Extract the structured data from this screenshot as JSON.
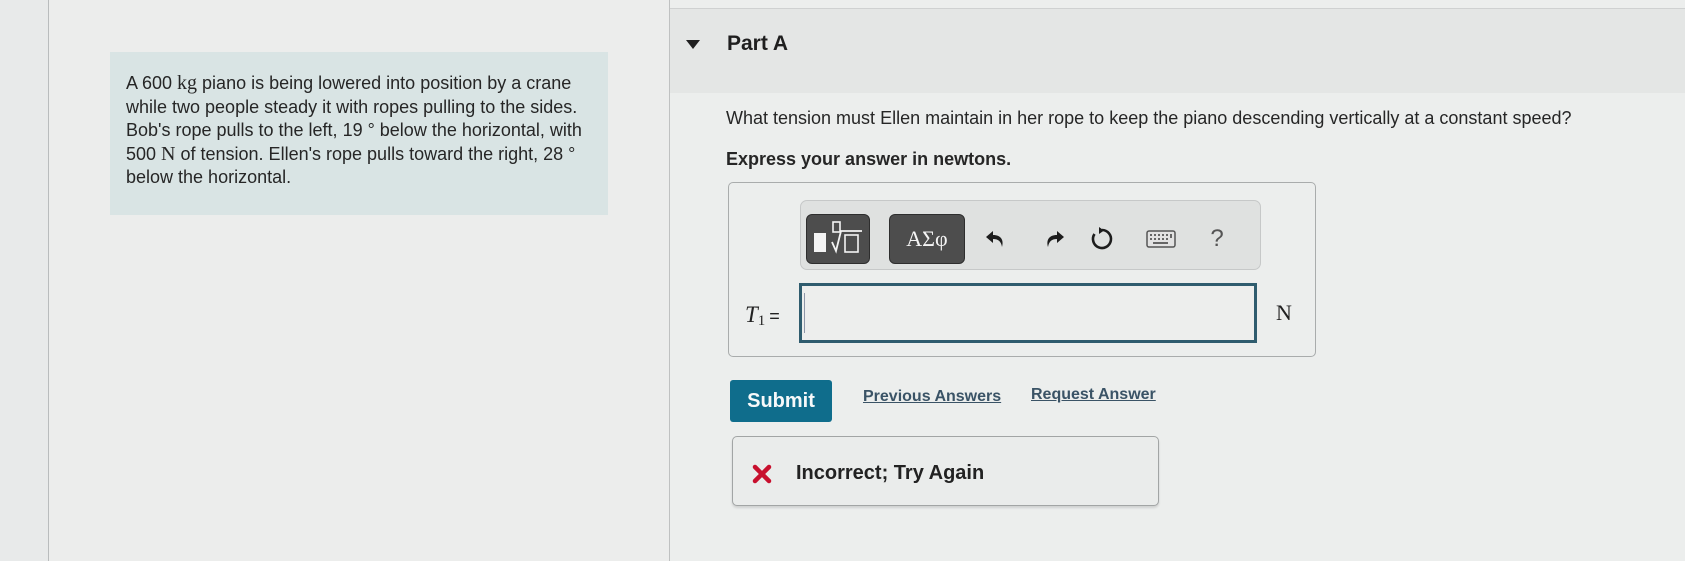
{
  "problem": {
    "text_1": "A 600 ",
    "unit_kg": "kg",
    "text_2": " piano is being lowered into position by a crane while two people steady it with ropes pulling to the sides. Bob's rope pulls to the left, 19 ° below the horizontal, with 500 ",
    "unit_N": "N",
    "text_3": " of tension. Ellen's rope pulls toward the right, 28 ° below the horizontal."
  },
  "part": {
    "title": "Part A",
    "question": "What tension must Ellen maintain in her rope to keep the piano descending vertically at a constant speed?",
    "instruction": "Express your answer in newtons."
  },
  "toolbar": {
    "templates_icon": "templates-icon",
    "greek_label": "ΑΣφ",
    "undo_icon": "undo-icon",
    "redo_icon": "redo-icon",
    "reset_icon": "reset-icon",
    "keyboard_icon": "keyboard-icon",
    "help_label": "?"
  },
  "answer": {
    "variable": "T",
    "subscript": "1",
    "equals": "=",
    "value": "",
    "unit": "N"
  },
  "actions": {
    "submit_label": "Submit",
    "previous_answers_label": "Previous Answers",
    "request_answer_label": "Request Answer"
  },
  "feedback": {
    "status": "incorrect",
    "message": "Incorrect; Try Again",
    "color": "#c8102e"
  },
  "colors": {
    "submit": "#0f6d8c",
    "input_border": "#2f5c6e",
    "problem_bg": "#d9e4e4"
  }
}
